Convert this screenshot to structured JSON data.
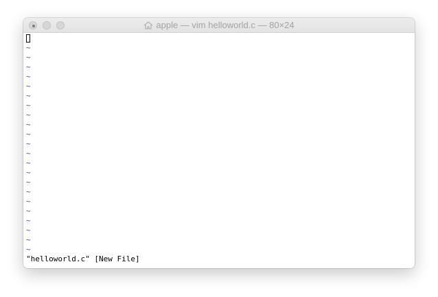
{
  "window": {
    "title": "apple — vim helloworld.c — 80×24",
    "title_icon": "home-icon"
  },
  "editor": {
    "tilde_char": "~",
    "tilde_count": 22,
    "status_line": "\"helloworld.c\" [New File]"
  },
  "colors": {
    "tilde": "#4a3df5",
    "title_text": "#a3a3a3",
    "background": "#ffffff"
  }
}
